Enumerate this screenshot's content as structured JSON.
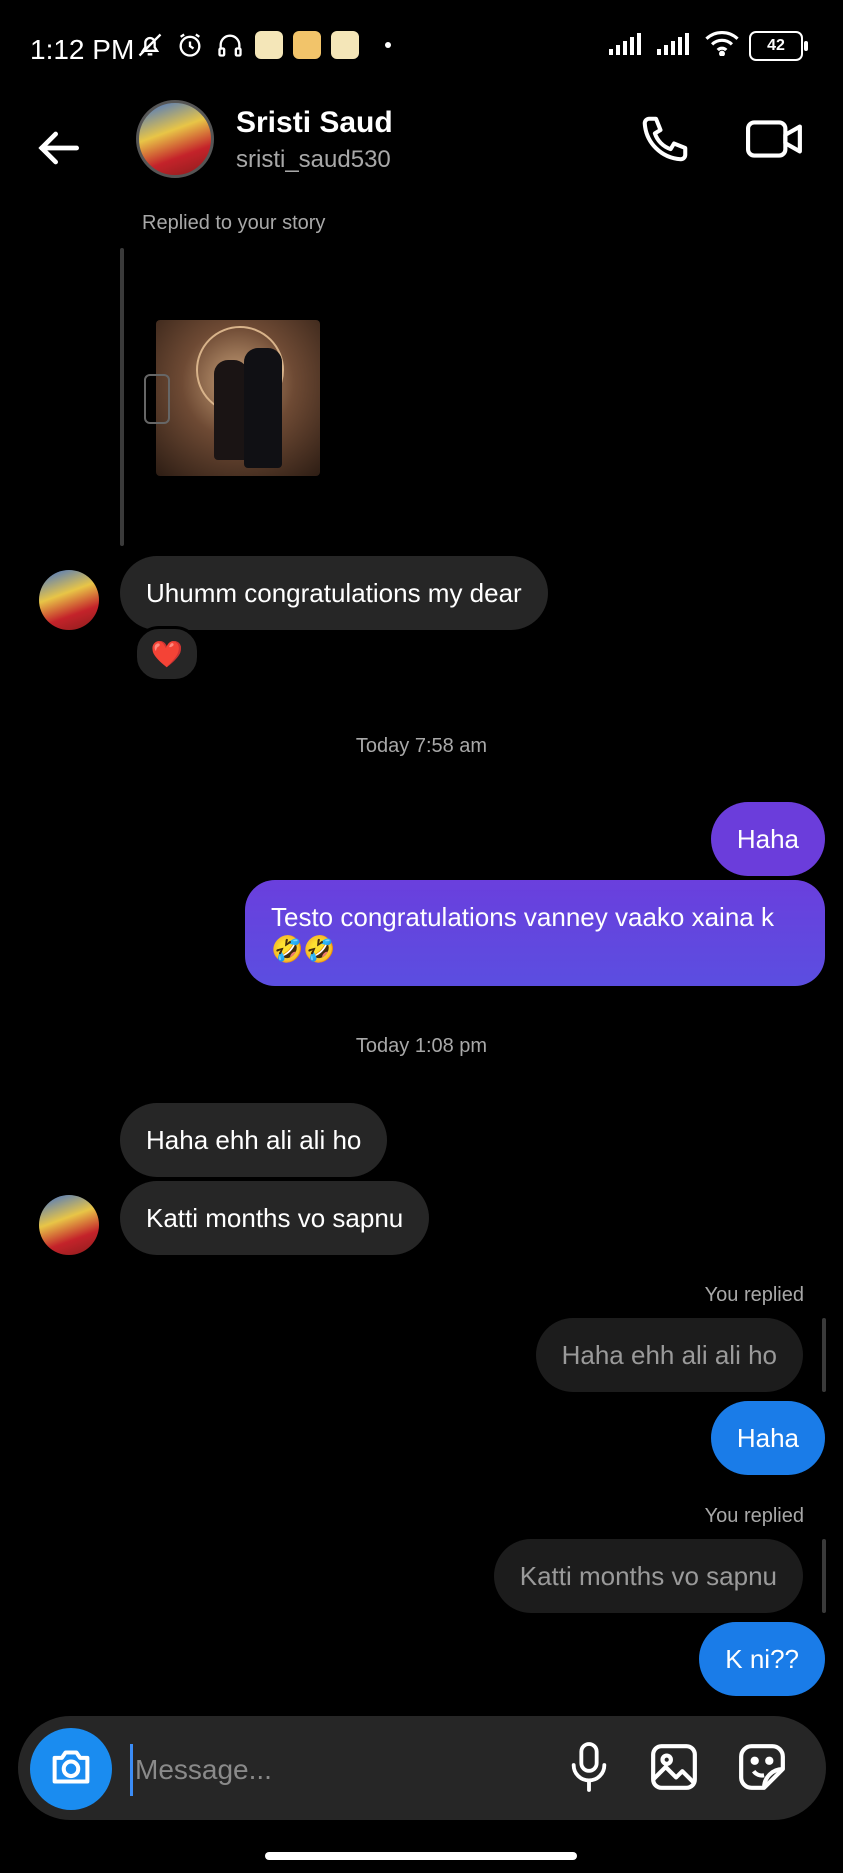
{
  "status_bar": {
    "time": "1:12 PM",
    "battery": "42",
    "icons_left": [
      "bell-off-icon",
      "alarm-icon",
      "headphones-icon",
      "app-badge-1",
      "app-badge-2",
      "app-badge-3"
    ],
    "icons_right": [
      "signal-icon",
      "signal-icon",
      "wifi-icon",
      "battery-icon"
    ]
  },
  "header": {
    "name": "Sristi Saud",
    "username": "sristi_saud530",
    "icons": [
      "back-arrow-icon",
      "phone-icon",
      "video-icon"
    ]
  },
  "story_reply": {
    "label": "Replied to your story"
  },
  "messages": [
    {
      "id": "m1",
      "direction": "in",
      "text": "Uhumm congratulations my dear",
      "reaction": "❤️"
    },
    {
      "id": "ts1",
      "type": "timestamp",
      "text": "Today 7:58 am"
    },
    {
      "id": "m2",
      "direction": "out",
      "text": "Haha"
    },
    {
      "id": "m3",
      "direction": "out",
      "text": "Testo congratulations vanney vaako xaina k 🤣🤣"
    },
    {
      "id": "ts2",
      "type": "timestamp",
      "text": "Today 1:08 pm"
    },
    {
      "id": "m4",
      "direction": "in",
      "text": "Haha ehh ali ali ho"
    },
    {
      "id": "m5",
      "direction": "in",
      "text": "Katti months vo sapnu"
    },
    {
      "id": "r1",
      "type": "reply_label",
      "text": "You replied"
    },
    {
      "id": "q1",
      "type": "quote",
      "text": "Haha ehh ali ali ho"
    },
    {
      "id": "m6",
      "direction": "out",
      "text": "Haha"
    },
    {
      "id": "r2",
      "type": "reply_label",
      "text": "You replied"
    },
    {
      "id": "q2",
      "type": "quote",
      "text": "Katti months vo sapnu"
    },
    {
      "id": "m7",
      "direction": "out",
      "text": "K ni??"
    }
  ],
  "composer": {
    "placeholder": "Message...",
    "icons": [
      "camera-icon",
      "microphone-icon",
      "gallery-icon",
      "sticker-icon"
    ]
  },
  "colors": {
    "background": "#000000",
    "incoming_bubble": "#262626",
    "outgoing_purple": "#6b3ddb",
    "outgoing_blue": "#1a7ce8",
    "camera_button": "#1a8cf0"
  }
}
